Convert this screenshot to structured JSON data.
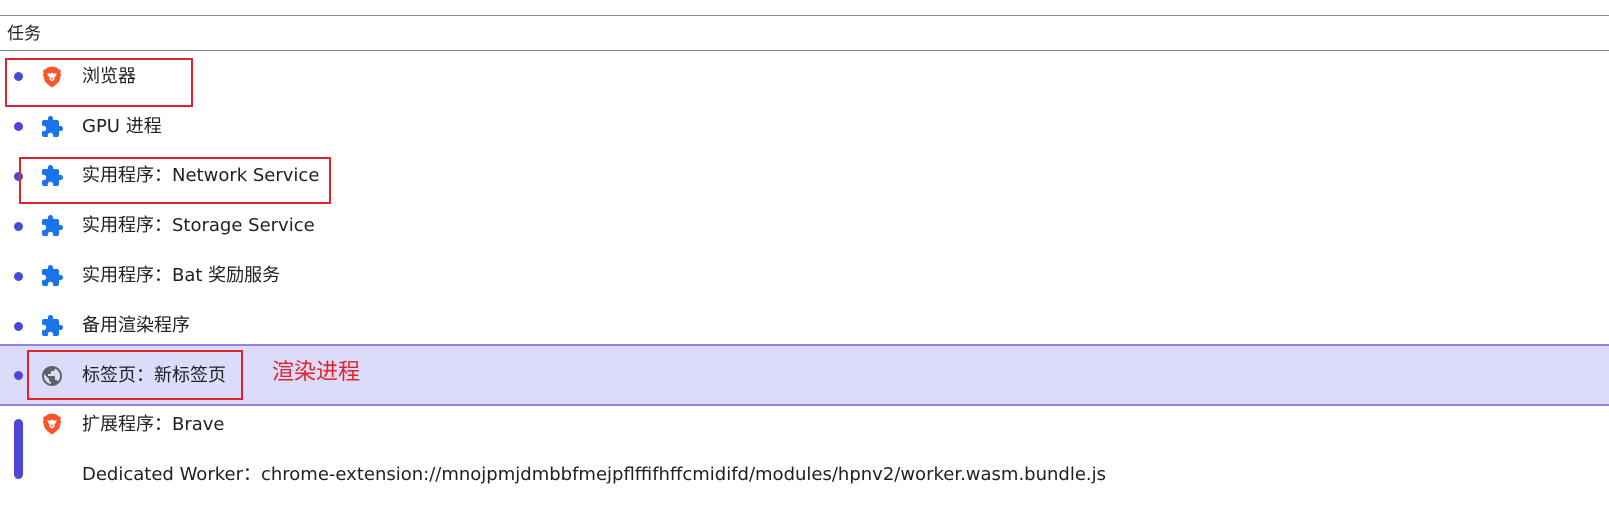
{
  "header": {
    "column_label": "任务"
  },
  "processes": [
    {
      "label": "浏览器",
      "icon": "brave-lion-icon",
      "selected": false
    },
    {
      "label": "GPU 进程",
      "icon": "puzzle-piece-icon",
      "selected": false
    },
    {
      "label": "实用程序：Network Service",
      "icon": "puzzle-piece-icon",
      "selected": false
    },
    {
      "label": "实用程序：Storage Service",
      "icon": "puzzle-piece-icon",
      "selected": false
    },
    {
      "label": "实用程序：Bat 奖励服务",
      "icon": "puzzle-piece-icon",
      "selected": false
    },
    {
      "label": "备用渲染程序",
      "icon": "puzzle-piece-icon",
      "selected": false
    },
    {
      "label": "标签页：新标签页",
      "icon": "globe-icon",
      "selected": true
    },
    {
      "label": "扩展程序：Brave",
      "icon": "brave-lion-icon",
      "selected": false
    },
    {
      "label": "Dedicated Worker：chrome-extension://mnojpmjdmbbfmejpflffifhffcmidifd/modules/hpnv2/worker.wasm.bundle.js",
      "icon": "",
      "selected": false
    }
  ],
  "annotation": {
    "text": "渲染进程",
    "color": "#e0232b"
  },
  "colors": {
    "selection_bg": "#dcdcfa",
    "selection_border": "#8a86e0",
    "bullet": "#4b47d8",
    "puzzle_icon": "#1a73e8",
    "brave_orange": "#fb542b",
    "globe_gray": "#5f6368"
  }
}
